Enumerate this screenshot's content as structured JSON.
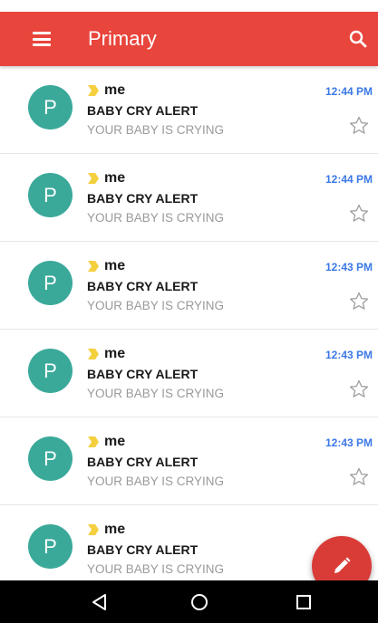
{
  "app_bar": {
    "title": "Primary",
    "background_color": "#e8453c",
    "menu_icon": "menu-icon",
    "search_icon": "search-icon"
  },
  "messages": [
    {
      "avatar_letter": "P",
      "sender": "me",
      "subject": "BABY CRY ALERT",
      "snippet": "YOUR BABY IS CRYING",
      "time": "12:44 PM",
      "important": true,
      "starred": false
    },
    {
      "avatar_letter": "P",
      "sender": "me",
      "subject": "BABY CRY ALERT",
      "snippet": "YOUR BABY IS CRYING",
      "time": "12:44 PM",
      "important": true,
      "starred": false
    },
    {
      "avatar_letter": "P",
      "sender": "me",
      "subject": "BABY CRY ALERT",
      "snippet": "YOUR BABY IS CRYING",
      "time": "12:43 PM",
      "important": true,
      "starred": false
    },
    {
      "avatar_letter": "P",
      "sender": "me",
      "subject": "BABY CRY ALERT",
      "snippet": "YOUR BABY IS CRYING",
      "time": "12:43 PM",
      "important": true,
      "starred": false
    },
    {
      "avatar_letter": "P",
      "sender": "me",
      "subject": "BABY CRY ALERT",
      "snippet": "YOUR BABY IS CRYING",
      "time": "12:43 PM",
      "important": true,
      "starred": false
    },
    {
      "avatar_letter": "P",
      "sender": "me",
      "subject": "BABY CRY ALERT",
      "snippet": "YOUR BABY IS CRYING",
      "time": "",
      "important": true,
      "starred": false
    }
  ],
  "colors": {
    "avatar": "#3aa99a",
    "time": "#3b78e7",
    "important_marker": "#f4d03f",
    "fab": "#d93c37"
  },
  "fab": {
    "icon": "pencil-icon"
  },
  "nav_bar": {
    "icons": [
      "back-icon",
      "home-icon",
      "recents-icon"
    ]
  }
}
